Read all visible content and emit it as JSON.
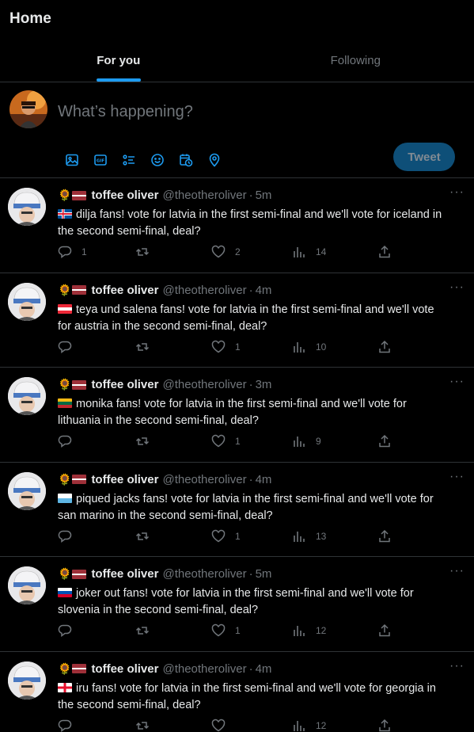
{
  "header": {
    "title": "Home"
  },
  "tabs": [
    {
      "label": "For you",
      "active": true
    },
    {
      "label": "Following",
      "active": false
    }
  ],
  "compose": {
    "placeholder": "What’s happening?",
    "tools": [
      "image-icon",
      "gif-icon",
      "poll-icon",
      "emoji-icon",
      "schedule-icon",
      "location-icon"
    ],
    "tweet_label": "Tweet"
  },
  "posts": [
    {
      "name": "toffee oliver",
      "handle": "@theotheroliver",
      "time": "5m",
      "flag": "iceland",
      "text": "dilja fans! vote for latvia in the first semi-final and we'll vote for iceland in the second semi-final, deal?",
      "replies": "1",
      "retweets": "",
      "likes": "2",
      "views": "14"
    },
    {
      "name": "toffee oliver",
      "handle": "@theotheroliver",
      "time": "4m",
      "flag": "austria",
      "text": "teya und salena fans! vote for latvia in the first semi-final and we'll vote for austria in the second semi-final, deal?",
      "replies": "",
      "retweets": "",
      "likes": "1",
      "views": "10"
    },
    {
      "name": "toffee oliver",
      "handle": "@theotheroliver",
      "time": "3m",
      "flag": "lithuania",
      "text": "monika fans! vote for latvia in the first semi-final and we'll vote for lithuania in the second semi-final, deal?",
      "replies": "",
      "retweets": "",
      "likes": "1",
      "views": "9"
    },
    {
      "name": "toffee oliver",
      "handle": "@theotheroliver",
      "time": "4m",
      "flag": "san-marino",
      "text": "piqued jacks fans! vote for latvia in the first semi-final and we'll vote for san marino in the second semi-final, deal?",
      "replies": "",
      "retweets": "",
      "likes": "1",
      "views": "13"
    },
    {
      "name": "toffee oliver",
      "handle": "@theotheroliver",
      "time": "5m",
      "flag": "slovenia",
      "text": "joker out fans! vote for latvia in the first semi-final and we'll vote for slovenia in the second semi-final, deal?",
      "replies": "",
      "retweets": "",
      "likes": "1",
      "views": "12"
    },
    {
      "name": "toffee oliver",
      "handle": "@theotheroliver",
      "time": "4m",
      "flag": "georgia",
      "text": "iru fans! vote for latvia in the first semi-final and we'll vote for georgia in the second semi-final, deal?",
      "replies": "",
      "retweets": "",
      "likes": "",
      "views": "12"
    }
  ],
  "colors": {
    "accent": "#1d9bf0",
    "muted": "#71767b",
    "border": "#2f3336",
    "background": "#000000"
  }
}
